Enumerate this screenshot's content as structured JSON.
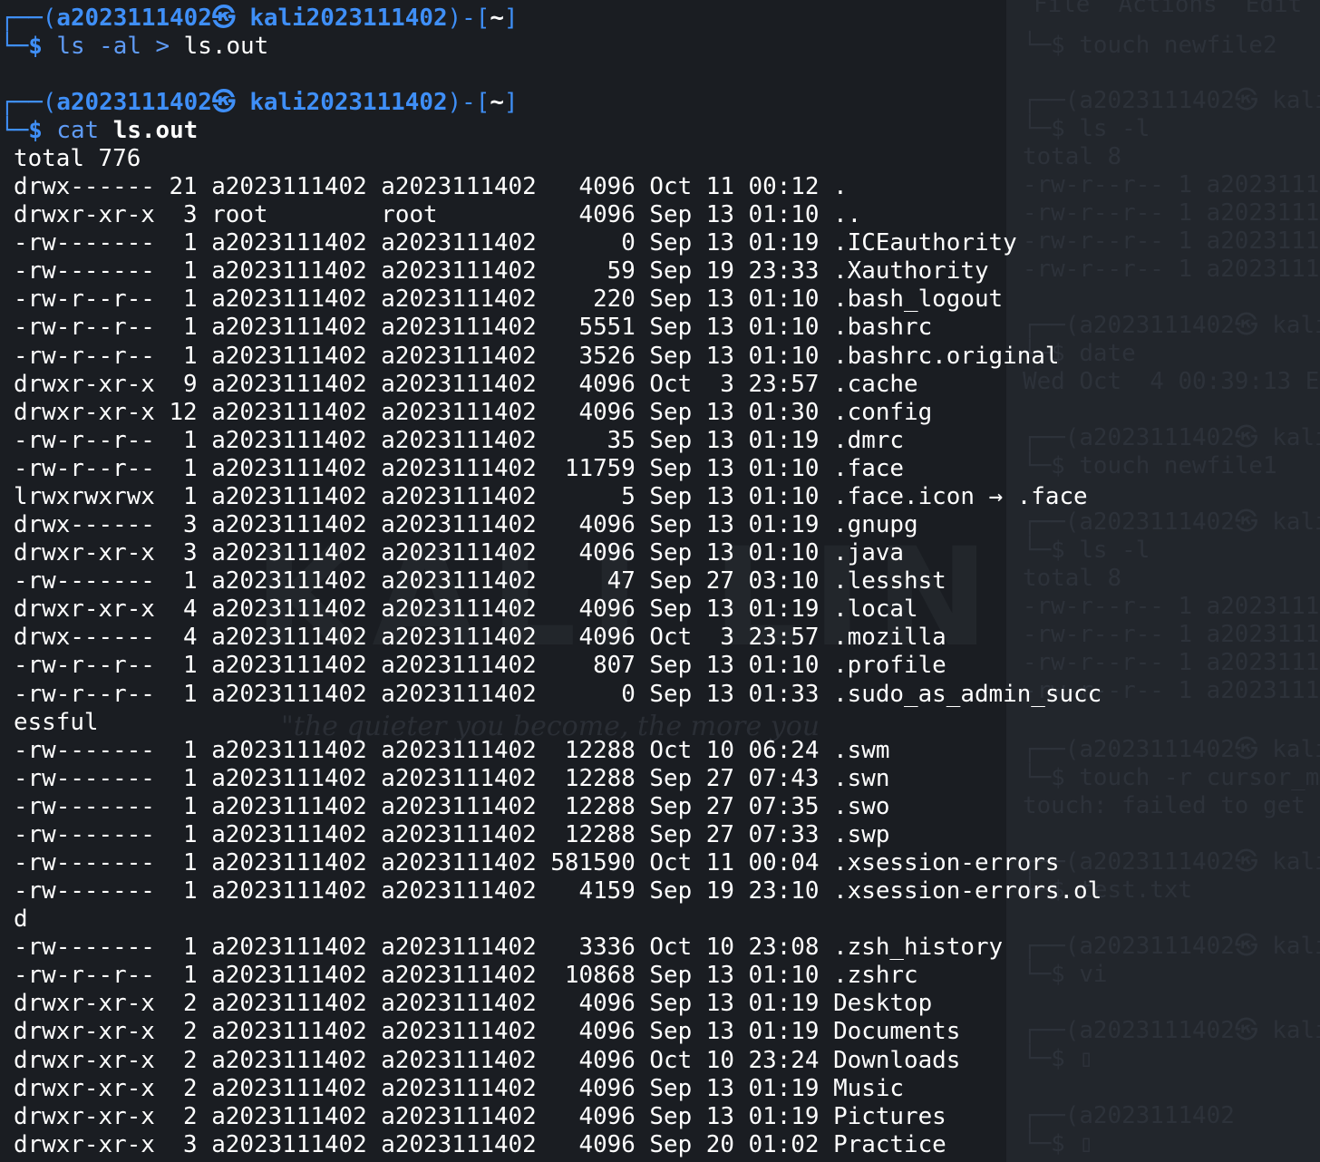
{
  "background_terminal": {
    "menu": "File  Actions  Edit  Vi",
    "lines": [
      "└─$ touch newfile2",
      "┌──(a2023111402㉿ kali",
      "└─$ ls -l",
      "total 8",
      "-rw-r--r-- 1 a20231114",
      "-rw-r--r-- 1 a20231114",
      "-rw-r--r-- 1 a20231114",
      "-rw-r--r-- 1 a20231114",
      "┌──(a2023111402㉿ kali",
      "└─$ date",
      "Wed Oct  4 00:39:13 E",
      "┌──(a2023111402㉿ kali",
      "└─$ touch newfile1",
      "┌──(a2023111402㉿ kali",
      "└─$ ls -l",
      "total 8",
      "-rw-r--r-- 1 a20231114",
      "-rw-r--r-- 1 a20231114",
      "-rw-r--r-- 1 a20231114",
      "-rw-r--r-- 1 a20231114",
      "┌──(a2023111402㉿ kali",
      "└─$ touch -r cursor_m",
      "touch: failed to get",
      "┌──(a2023111402㉿ kali",
      "└─$ test.txt",
      "┌──(a2023111402㉿ kali",
      "└─$ vi",
      "┌──(a2023111402㉿ kali",
      "└─$ ▯",
      "┌──(a2023111402",
      "└─$ ▯"
    ]
  },
  "wallpaper": {
    "mark": "KALI LINUX",
    "quote": "\"the quieter you become, the more you"
  },
  "prompt": {
    "open": "┌──(",
    "user": "a2023111402",
    "sep": "㉿ ",
    "host": "kali2023111402",
    "mid": ")-[",
    "path": "~",
    "close": "]",
    "corner": "└─",
    "dollar": "$ "
  },
  "commands": [
    {
      "name": "ls",
      "args": " -al ",
      "op": ">",
      "target": " ls.out"
    },
    {
      "name": "cat",
      "args": " ",
      "target_bold": "ls.out"
    }
  ],
  "output": [
    "total 776",
    "drwx------ 21 a2023111402 a2023111402   4096 Oct 11 00:12 .",
    "drwxr-xr-x  3 root        root          4096 Sep 13 01:10 ..",
    "-rw-------  1 a2023111402 a2023111402      0 Sep 13 01:19 .ICEauthority",
    "-rw-------  1 a2023111402 a2023111402     59 Sep 19 23:33 .Xauthority",
    "-rw-r--r--  1 a2023111402 a2023111402    220 Sep 13 01:10 .bash_logout",
    "-rw-r--r--  1 a2023111402 a2023111402   5551 Sep 13 01:10 .bashrc",
    "-rw-r--r--  1 a2023111402 a2023111402   3526 Sep 13 01:10 .bashrc.original",
    "drwxr-xr-x  9 a2023111402 a2023111402   4096 Oct  3 23:57 .cache",
    "drwxr-xr-x 12 a2023111402 a2023111402   4096 Sep 13 01:30 .config",
    "-rw-r--r--  1 a2023111402 a2023111402     35 Sep 13 01:19 .dmrc",
    "-rw-r--r--  1 a2023111402 a2023111402  11759 Sep 13 01:10 .face",
    "lrwxrwxrwx  1 a2023111402 a2023111402      5 Sep 13 01:10 .face.icon → .face",
    "drwx------  3 a2023111402 a2023111402   4096 Sep 13 01:19 .gnupg",
    "drwxr-xr-x  3 a2023111402 a2023111402   4096 Sep 13 01:10 .java",
    "-rw-------  1 a2023111402 a2023111402     47 Sep 27 03:10 .lesshst",
    "drwxr-xr-x  4 a2023111402 a2023111402   4096 Sep 13 01:19 .local",
    "drwx------  4 a2023111402 a2023111402   4096 Oct  3 23:57 .mozilla",
    "-rw-r--r--  1 a2023111402 a2023111402    807 Sep 13 01:10 .profile",
    "-rw-r--r--  1 a2023111402 a2023111402      0 Sep 13 01:33 .sudo_as_admin_succ",
    "essful",
    "-rw-------  1 a2023111402 a2023111402  12288 Oct 10 06:24 .swm",
    "-rw-------  1 a2023111402 a2023111402  12288 Sep 27 07:43 .swn",
    "-rw-------  1 a2023111402 a2023111402  12288 Sep 27 07:35 .swo",
    "-rw-------  1 a2023111402 a2023111402  12288 Sep 27 07:33 .swp",
    "-rw-------  1 a2023111402 a2023111402 581590 Oct 11 00:04 .xsession-errors",
    "-rw-------  1 a2023111402 a2023111402   4159 Sep 19 23:10 .xsession-errors.ol",
    "d",
    "-rw-------  1 a2023111402 a2023111402   3336 Oct 10 23:08 .zsh_history",
    "-rw-r--r--  1 a2023111402 a2023111402  10868 Sep 13 01:10 .zshrc",
    "drwxr-xr-x  2 a2023111402 a2023111402   4096 Sep 13 01:19 Desktop",
    "drwxr-xr-x  2 a2023111402 a2023111402   4096 Sep 13 01:19 Documents",
    "drwxr-xr-x  2 a2023111402 a2023111402   4096 Oct 10 23:24 Downloads",
    "drwxr-xr-x  2 a2023111402 a2023111402   4096 Sep 13 01:19 Music",
    "drwxr-xr-x  2 a2023111402 a2023111402   4096 Sep 13 01:19 Pictures",
    "drwxr-xr-x  3 a2023111402 a2023111402   4096 Sep 20 01:02 Practice"
  ]
}
